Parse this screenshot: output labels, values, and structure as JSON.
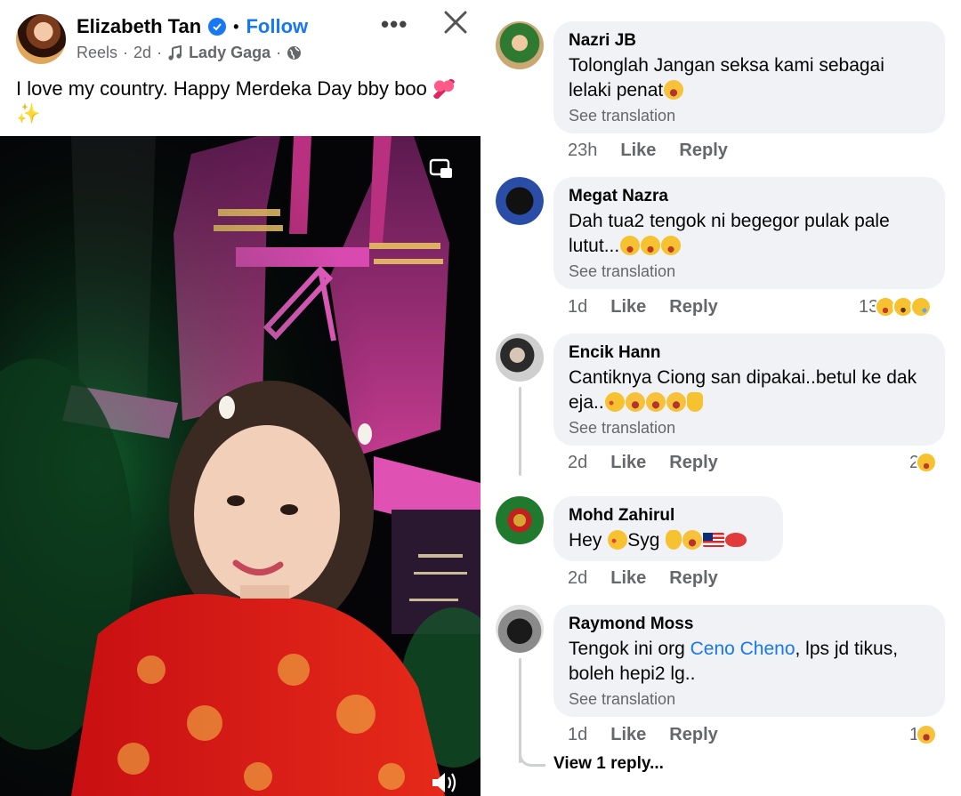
{
  "post": {
    "author": "Elizabeth Tan",
    "follow_label": "Follow",
    "type": "Reels",
    "age": "2d",
    "music": "Lady Gaga",
    "caption": "I love my country. Happy Merdeka Day bby boo",
    "caption_emojis": [
      "heart-sparkle-emoji",
      "sparkles-emoji"
    ]
  },
  "comments": [
    {
      "author": "Nazri JB",
      "text": "Tolonglah Jangan seksa kami sebagai lelaki penat",
      "emojis": [
        "woozy-face-emoji"
      ],
      "see_translation": "See translation",
      "time": "23h",
      "like": "Like",
      "reply": "Reply"
    },
    {
      "author": "Megat Nazra",
      "text": "Dah tua2 tengok ni begegor pulak pale lutut...",
      "emojis": [
        "squinting-tongue-emoji",
        "squinting-tongue-emoji",
        "squinting-tongue-emoji"
      ],
      "see_translation": "See translation",
      "time": "1d",
      "like": "Like",
      "reply": "Reply",
      "reaction_count": "13"
    },
    {
      "author": "Encik Hann",
      "text": "Cantiknya Ciong san dipakai..betul ke dak eja..",
      "emojis": [
        "yawn-emoji",
        "rofl-emoji",
        "rofl-emoji",
        "rofl-emoji",
        "folded-hands-emoji"
      ],
      "see_translation": "See translation",
      "time": "2d",
      "like": "Like",
      "reply": "Reply",
      "reaction_count": "2"
    },
    {
      "author": "Mohd Zahirul",
      "text_before": "Hey",
      "text_mid": "Syg",
      "emojis": [
        "smiling-hearts-emoji",
        "ok-hand-emoji",
        "hugging-emoji",
        "malaysia-flag-emoji",
        "kiss-lips-emoji"
      ],
      "time": "2d",
      "like": "Like",
      "reply": "Reply"
    },
    {
      "author": "Raymond Moss",
      "text_before": "Tengok ini org",
      "mention": "Ceno Cheno",
      "text_after": ", lps jd tikus, boleh hepi2 lg..",
      "see_translation": "See translation",
      "time": "1d",
      "like": "Like",
      "reply": "Reply",
      "reaction_count": "1"
    }
  ],
  "view_replies": "View 1 reply..."
}
